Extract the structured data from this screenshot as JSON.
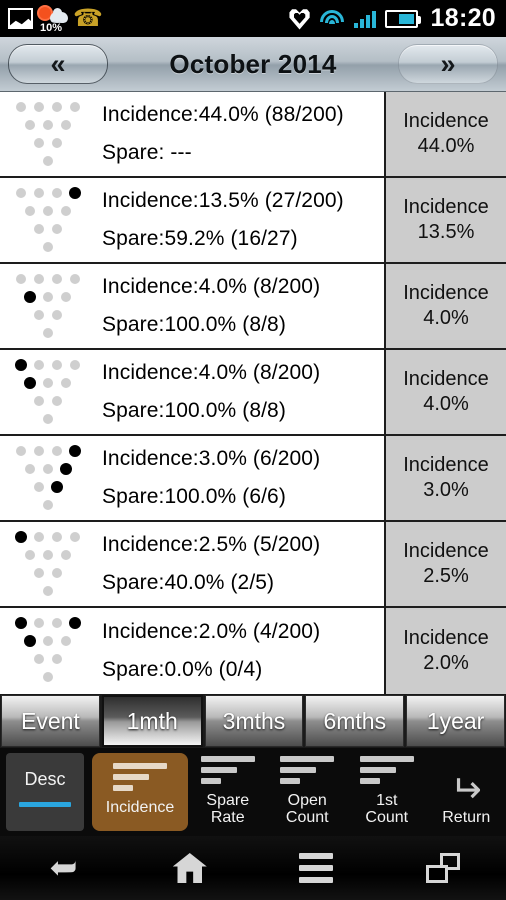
{
  "status_bar": {
    "icons_left": [
      "gallery-icon",
      "weather-icon",
      "missed-call-icon"
    ],
    "weather_percent": "10%",
    "icons_right": [
      "heart-icon",
      "wifi-icon",
      "signal-icon",
      "battery-icon"
    ],
    "clock": "18:20"
  },
  "header": {
    "prev_label": "«",
    "title": "October 2014",
    "next_label": "»"
  },
  "rows": [
    {
      "incidence_line": "Incidence:44.0%  (88/200)",
      "spare_line": "Spare: ---",
      "value_label": "Incidence",
      "value_number": "44.0%",
      "pattern": [
        [
          0,
          0,
          0,
          0
        ],
        [
          0,
          0,
          0
        ],
        [
          0,
          0
        ],
        [
          0
        ]
      ]
    },
    {
      "incidence_line": "Incidence:13.5%  (27/200)",
      "spare_line": "Spare:59.2%  (16/27)",
      "value_label": "Incidence",
      "value_number": "13.5%",
      "pattern": [
        [
          0,
          0,
          0,
          1
        ],
        [
          0,
          0,
          0
        ],
        [
          0,
          0
        ],
        [
          0
        ]
      ]
    },
    {
      "incidence_line": "Incidence:4.0%  (8/200)",
      "spare_line": "Spare:100.0%  (8/8)",
      "value_label": "Incidence",
      "value_number": "4.0%",
      "pattern": [
        [
          0,
          0,
          0,
          0
        ],
        [
          1,
          0,
          0
        ],
        [
          0,
          0
        ],
        [
          0
        ]
      ]
    },
    {
      "incidence_line": "Incidence:4.0%  (8/200)",
      "spare_line": "Spare:100.0%  (8/8)",
      "value_label": "Incidence",
      "value_number": "4.0%",
      "pattern": [
        [
          1,
          0,
          0,
          0
        ],
        [
          1,
          0,
          0
        ],
        [
          0,
          0
        ],
        [
          0
        ]
      ]
    },
    {
      "incidence_line": "Incidence:3.0%  (6/200)",
      "spare_line": "Spare:100.0%  (6/6)",
      "value_label": "Incidence",
      "value_number": "3.0%",
      "pattern": [
        [
          0,
          0,
          0,
          1
        ],
        [
          0,
          0,
          1
        ],
        [
          0,
          1
        ],
        [
          0
        ]
      ]
    },
    {
      "incidence_line": "Incidence:2.5%  (5/200)",
      "spare_line": "Spare:40.0%  (2/5)",
      "value_label": "Incidence",
      "value_number": "2.5%",
      "pattern": [
        [
          1,
          0,
          0,
          0
        ],
        [
          0,
          0,
          0
        ],
        [
          0,
          0
        ],
        [
          0
        ]
      ]
    },
    {
      "incidence_line": "Incidence:2.0%  (4/200)",
      "spare_line": "Spare:0.0%  (0/4)",
      "value_label": "Incidence",
      "value_number": "2.0%",
      "pattern": [
        [
          1,
          0,
          0,
          1
        ],
        [
          1,
          0,
          0
        ],
        [
          0,
          0
        ],
        [
          0
        ]
      ]
    }
  ],
  "period_tabs": [
    {
      "label": "Event",
      "active": false
    },
    {
      "label": "1mth",
      "active": true
    },
    {
      "label": "3mths",
      "active": false
    },
    {
      "label": "6mths",
      "active": false
    },
    {
      "label": "1year",
      "active": false
    }
  ],
  "action_bar": [
    {
      "label": "Desc",
      "icon": "sort-direction-icon",
      "active": false,
      "highlight": "desc"
    },
    {
      "label": "Incidence",
      "icon": "sort-bars-icon",
      "active": true,
      "highlight": "incidence"
    },
    {
      "label": "Spare\nRate",
      "icon": "sort-bars-icon",
      "active": false,
      "highlight": "none"
    },
    {
      "label": "Open\nCount",
      "icon": "sort-bars-icon",
      "active": false,
      "highlight": "none"
    },
    {
      "label": "1st\nCount",
      "icon": "sort-bars-icon",
      "active": false,
      "highlight": "none"
    },
    {
      "label": "Return",
      "icon": "return-arrow-icon",
      "active": false,
      "highlight": "none"
    }
  ],
  "action_labels": {
    "desc": "Desc",
    "incidence": "Incidence",
    "spare_rate_l1": "Spare",
    "spare_rate_l2": "Rate",
    "open_count_l1": "Open",
    "open_count_l2": "Count",
    "first_count_l1": "1st",
    "first_count_l2": "Count",
    "return": "Return"
  },
  "system_nav": [
    "back-icon",
    "home-icon",
    "menu-icon",
    "recent-apps-icon"
  ],
  "colors": {
    "accent_blue": "#2aa6df",
    "highlight_brown": "#8a5a23",
    "value_cell_bg": "#cccccc",
    "status_icon_blue": "#29b6d8"
  }
}
